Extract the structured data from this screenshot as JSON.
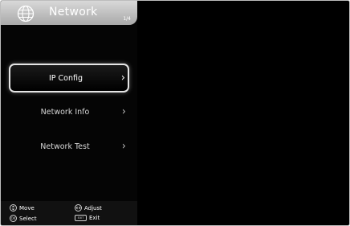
{
  "header": {
    "title": "Network",
    "page_indicator": "1/4"
  },
  "menu": {
    "items": [
      {
        "label": "IP Config",
        "selected": true
      },
      {
        "label": "Network Info",
        "selected": false
      },
      {
        "label": "Network Test",
        "selected": false
      }
    ]
  },
  "footer": {
    "move_label": "Move",
    "adjust_label": "Adjust",
    "select_label": "Select",
    "exit_label": "Exit",
    "ok_key": "OK",
    "exit_key": "EXIT"
  },
  "icons": {
    "header": "globe-icon",
    "item_arrow": "chevron-right-icon",
    "move": "up-down-key-icon",
    "adjust": "left-right-key-icon",
    "select": "ok-key-icon",
    "exit": "exit-key-icon"
  },
  "colors": {
    "background": "#000000",
    "header_gradient_top": "#d9d9d9",
    "header_gradient_bottom": "#a9a9a9",
    "selection_border": "#e6e6e6",
    "text": "#d8d8d8"
  }
}
